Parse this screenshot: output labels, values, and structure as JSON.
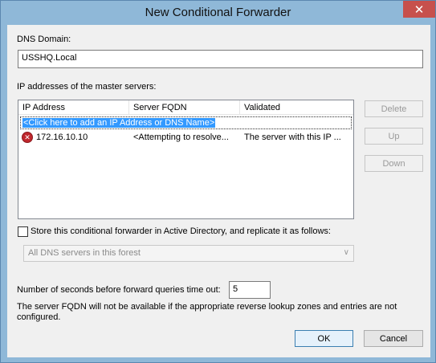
{
  "window": {
    "title": "New Conditional Forwarder",
    "close_glyph": "✕"
  },
  "dns_domain": {
    "label": "DNS Domain:",
    "value": "USSHQ.Local"
  },
  "master_servers": {
    "label": "IP addresses of the master servers:",
    "columns": [
      "IP Address",
      "Server FQDN",
      "Validated"
    ],
    "add_prompt": "<Click here to add an IP Address or DNS Name>",
    "rows": [
      {
        "icon": "error-icon",
        "ip": "172.16.10.10",
        "fqdn": "<Attempting to resolve...",
        "validated": "The server with this IP ..."
      }
    ]
  },
  "side_buttons": {
    "delete": "Delete",
    "up": "Up",
    "down": "Down"
  },
  "replication": {
    "checkbox_label": "Store this conditional forwarder in Active Directory, and replicate it as follows:",
    "checked": false,
    "scope_selected": "All DNS servers in this forest"
  },
  "timeout": {
    "label": "Number of seconds before forward queries time out:",
    "value": "5"
  },
  "note": {
    "line1": "The server FQDN will not be available if the appropriate reverse lookup zones and entries are not",
    "line2": "configured."
  },
  "footer": {
    "ok": "OK",
    "cancel": "Cancel"
  },
  "colors": {
    "title_bar": "#8fb8d8",
    "close_button": "#c7504c",
    "selection": "#3399ff",
    "error_icon": "#c0272d"
  }
}
